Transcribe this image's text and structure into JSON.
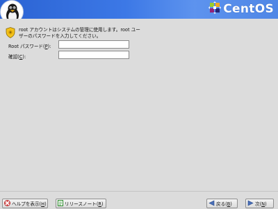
{
  "header": {
    "brand_name": "CentOS",
    "logo_icon": "tux-penguin-icon",
    "brand_icon": "centos-logo-icon",
    "banner_color": "#3c78e6"
  },
  "content": {
    "instruction_icon": "shield-icon",
    "instruction_text": "root アカウントはシステムの管理に使用します。root ユー\nザーのパスワードを入力してください。",
    "root_password": {
      "label_prefix": "Root パスワード(",
      "mnemonic": "P",
      "label_suffix": "):",
      "value": ""
    },
    "confirm": {
      "label_prefix": "確認(",
      "mnemonic": "C",
      "label_suffix": "):",
      "value": ""
    }
  },
  "footer": {
    "help_button": {
      "prefix": "ヘルプを表示(",
      "mnemonic": "H",
      "suffix": ")",
      "icon": "help-icon"
    },
    "release_notes_button": {
      "prefix": "リリースノート(",
      "mnemonic": "R",
      "suffix": ")",
      "icon": "document-icon"
    },
    "back_button": {
      "prefix": "戻る(",
      "mnemonic": "B",
      "suffix": ")",
      "icon": "back-arrow-icon"
    },
    "next_button": {
      "prefix": "次(",
      "mnemonic": "N",
      "suffix": ")",
      "icon": "next-arrow-icon"
    }
  }
}
